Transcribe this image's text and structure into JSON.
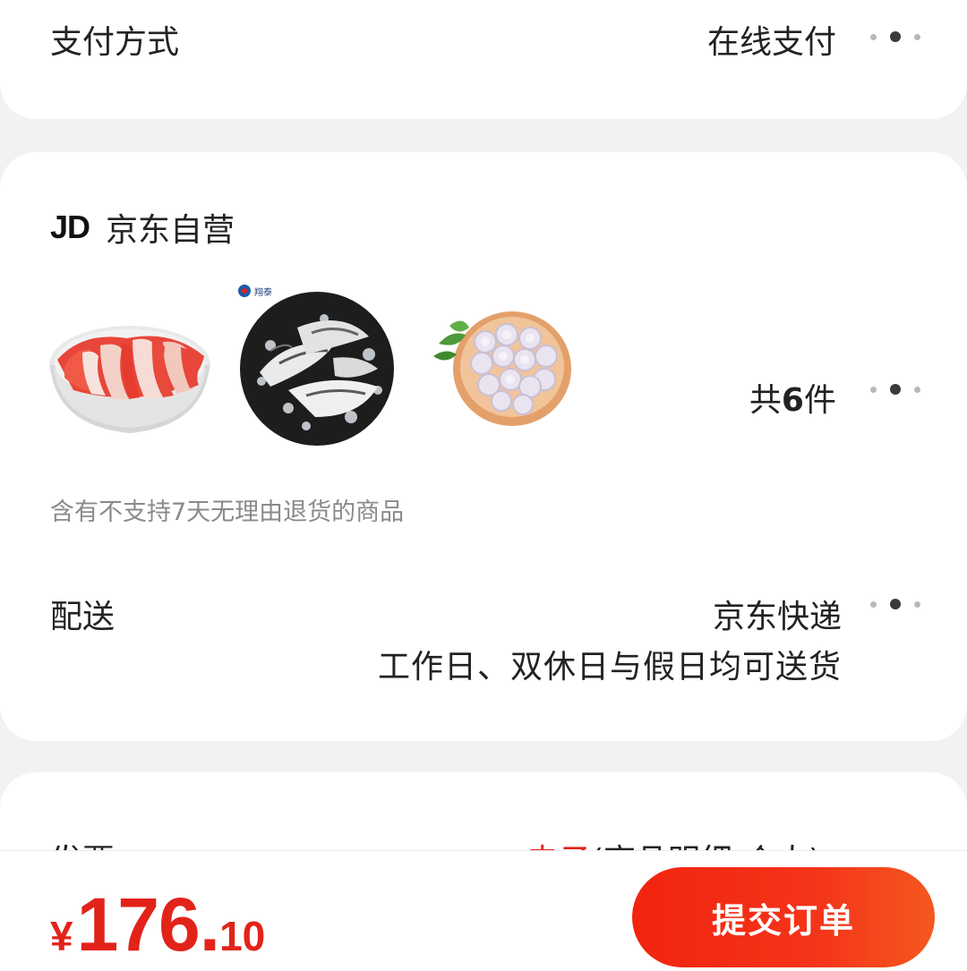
{
  "payment": {
    "label": "支付方式",
    "value": "在线支付"
  },
  "order": {
    "shop_logo": "JD",
    "shop_name": "京东自营",
    "products": [
      {
        "name": "beef-slices-bowl",
        "brand_text": ""
      },
      {
        "name": "fish-fillet-plate",
        "brand_text": "翔泰"
      },
      {
        "name": "shrimp-plate",
        "brand_text": ""
      }
    ],
    "count_prefix": "共",
    "count_number": "6",
    "count_suffix": "件",
    "return_notice": "含有不支持7天无理由退货的商品"
  },
  "delivery": {
    "label": "配送",
    "method": "京东快递",
    "schedule": "工作日、双休日与假日均可送货"
  },
  "invoice": {
    "label": "发票",
    "type_highlight": "电子",
    "type_detail": "(商品明细-个人)"
  },
  "footer": {
    "currency": "¥",
    "price_integer": "176.",
    "price_decimal": "10",
    "submit_label": "提交订单"
  },
  "colors": {
    "accent": "#e2231a",
    "background": "#f2f2f2"
  },
  "icons": [
    "more-dots-icon",
    "jd-logo-icon"
  ]
}
